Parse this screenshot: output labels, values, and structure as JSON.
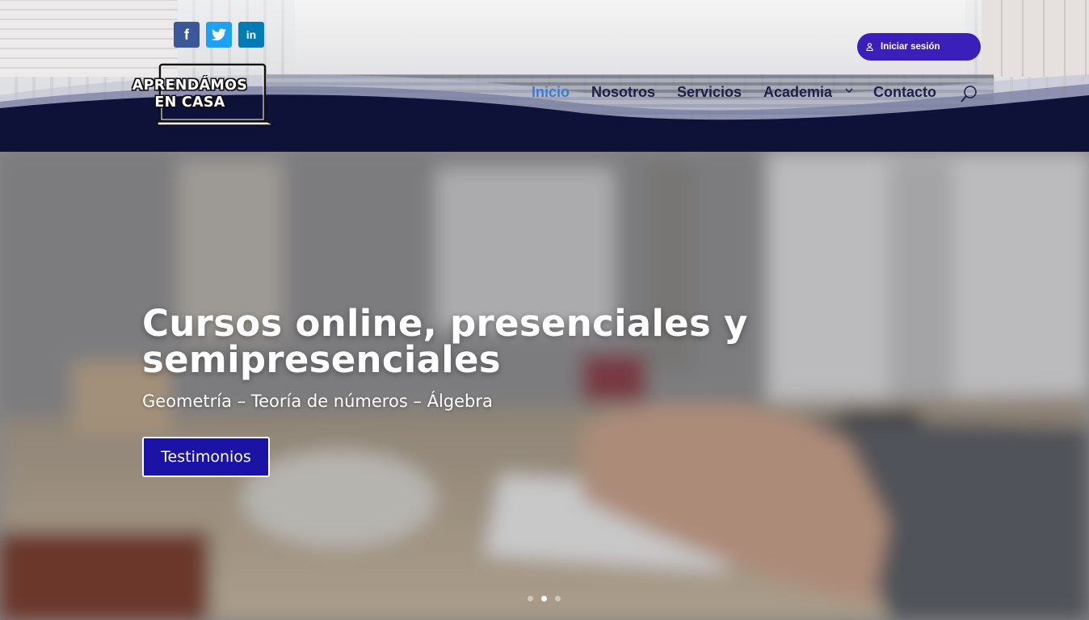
{
  "header": {
    "brand_color": "#0f1238",
    "social": [
      {
        "name": "facebook",
        "glyph": "f"
      },
      {
        "name": "twitter",
        "glyph": "twitter-bird"
      },
      {
        "name": "linkedin",
        "glyph": "in"
      }
    ],
    "login": {
      "label": "Iniciar sesión",
      "color": "#3a1fbb"
    },
    "logo": {
      "line1": "APRENDÁMOS",
      "line2": "EN CASA"
    },
    "nav": {
      "items": [
        {
          "label": "Inicio",
          "active": true
        },
        {
          "label": "Nosotros",
          "active": false
        },
        {
          "label": "Servicios",
          "active": false
        },
        {
          "label": "Academia",
          "active": false,
          "has_submenu": true
        },
        {
          "label": "Contacto",
          "active": false
        }
      ],
      "active_color": "#3a7bd5"
    }
  },
  "hero": {
    "title": "Cursos online, presenciales y semipresenciales",
    "subtitle": "Geometría – Teoría de números – Álgebra",
    "button_label": "Testimonios",
    "button_color": "#1a13a6",
    "slides": 3,
    "active_slide": 2
  }
}
